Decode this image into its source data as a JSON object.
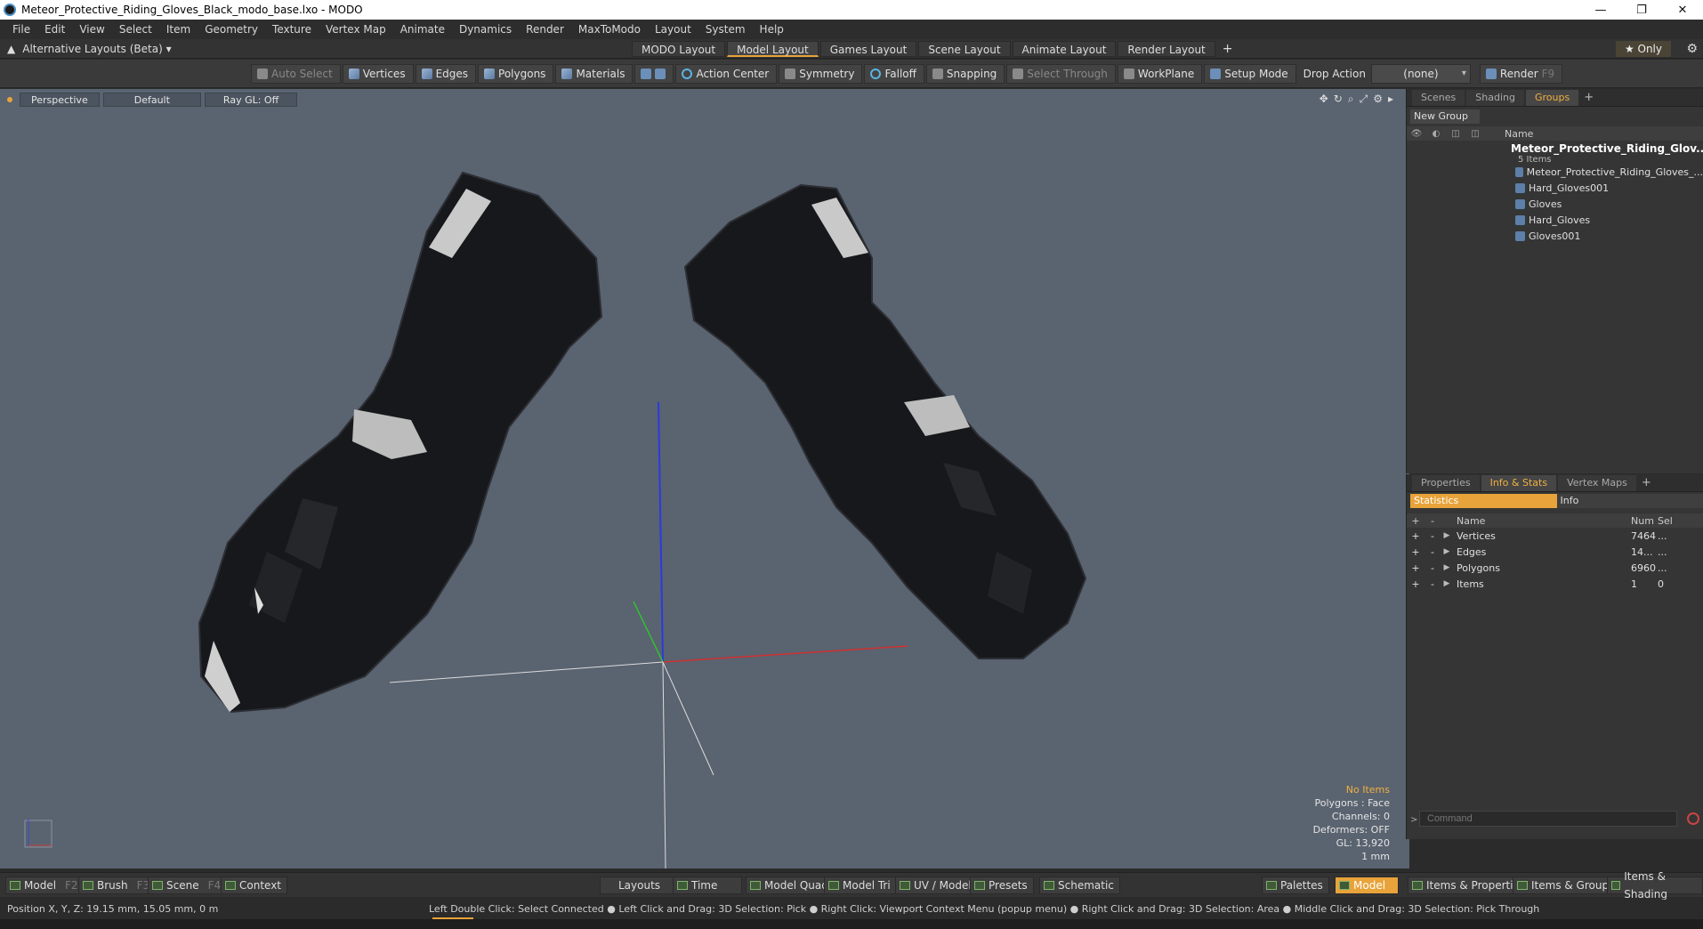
{
  "window": {
    "title": "Meteor_Protective_Riding_Gloves_Black_modo_base.lxo - MODO",
    "minimize": "—",
    "maximize": "❐",
    "close": "✕"
  },
  "menu": [
    "File",
    "Edit",
    "View",
    "Select",
    "Item",
    "Geometry",
    "Texture",
    "Vertex Map",
    "Animate",
    "Dynamics",
    "Render",
    "MaxToModo",
    "Layout",
    "System",
    "Help"
  ],
  "layoutbar": {
    "alt_layouts": "Alternative Layouts (Beta) ▾",
    "tabs": [
      "MODO Layout",
      "Model Layout",
      "Games Layout",
      "Scene Layout",
      "Animate Layout",
      "Render Layout"
    ],
    "active_tab": "Model Layout",
    "only_label": "★  Only"
  },
  "toolbar": {
    "auto_select": "Auto Select",
    "vertices": "Vertices",
    "edges": "Edges",
    "polygons": "Polygons",
    "materials": "Materials",
    "action_center": "Action Center",
    "symmetry": "Symmetry",
    "falloff": "Falloff",
    "snapping": "Snapping",
    "select_through": "Select Through",
    "workplane": "WorkPlane",
    "setup_mode": "Setup Mode",
    "drop_action_label": "Drop Action",
    "drop_action_value": "(none)",
    "render": "Render",
    "render_key": "F9"
  },
  "viewport": {
    "view": "Perspective",
    "shading": "Default",
    "raygl": "Ray GL: Off",
    "info": {
      "items": "No Items",
      "polygons": "Polygons : Face",
      "channels": "Channels: 0",
      "deformers": "Deformers: OFF",
      "gl": "GL: 13,920",
      "scale": "1 mm"
    }
  },
  "scenes_panel": {
    "tabs": [
      "Scenes",
      "Shading",
      "Groups"
    ],
    "active_tab": "Groups",
    "new_group": "New Group",
    "name_header": "Name",
    "root_name": "Meteor_Protective_Riding_Glov...",
    "root_sub": "5 Items",
    "items": [
      "Meteor_Protective_Riding_Gloves_...",
      "Hard_Gloves001",
      "Gloves",
      "Hard_Gloves",
      "Gloves001"
    ]
  },
  "stats_panel": {
    "tabs": [
      "Properties",
      "Info & Stats",
      "Vertex Maps"
    ],
    "active_tab": "Info & Stats",
    "sub_tabs": [
      "Statistics",
      "Info"
    ],
    "headers": {
      "name": "Name",
      "num": "Num",
      "sel": "Sel"
    },
    "rows": [
      {
        "name": "Vertices",
        "num": "7464",
        "sel": "..."
      },
      {
        "name": "Edges",
        "num": "14...",
        "sel": "..."
      },
      {
        "name": "Polygons",
        "num": "6960",
        "sel": "..."
      },
      {
        "name": "Items",
        "num": "1",
        "sel": "0"
      }
    ],
    "command_placeholder": "Command"
  },
  "bottombar": {
    "model": "Model",
    "model_key": "F2",
    "brush": "Brush",
    "brush_key": "F3",
    "scene": "Scene",
    "scene_key": "F4",
    "context": "Context",
    "layouts": "Layouts",
    "time": "Time",
    "model_quad": "Model Quad",
    "model_tri": "Model Tri",
    "uv_model": "UV / Model",
    "presets": "Presets",
    "schematic": "Schematic",
    "palettes": "Palettes",
    "model_active": "Model",
    "items_props": "Items & Properties",
    "items_groups": "Items & Groups",
    "items_shading": "Items & Shading"
  },
  "status": {
    "position": "Position X, Y, Z:   19.15 mm, 15.05 mm, 0 m",
    "hints": "Left Double Click: Select Connected ● Left Click and Drag: 3D Selection: Pick ● Right Click: Viewport Context Menu (popup menu) ● Right Click and Drag: 3D Selection: Area ● Middle Click and Drag: 3D Selection: Pick Through"
  },
  "colors": {
    "accent": "#e8a33a",
    "viewport_bg": "#5a6370",
    "axis_x": "#d03030",
    "axis_y": "#30c030",
    "axis_z": "#3040e0"
  }
}
